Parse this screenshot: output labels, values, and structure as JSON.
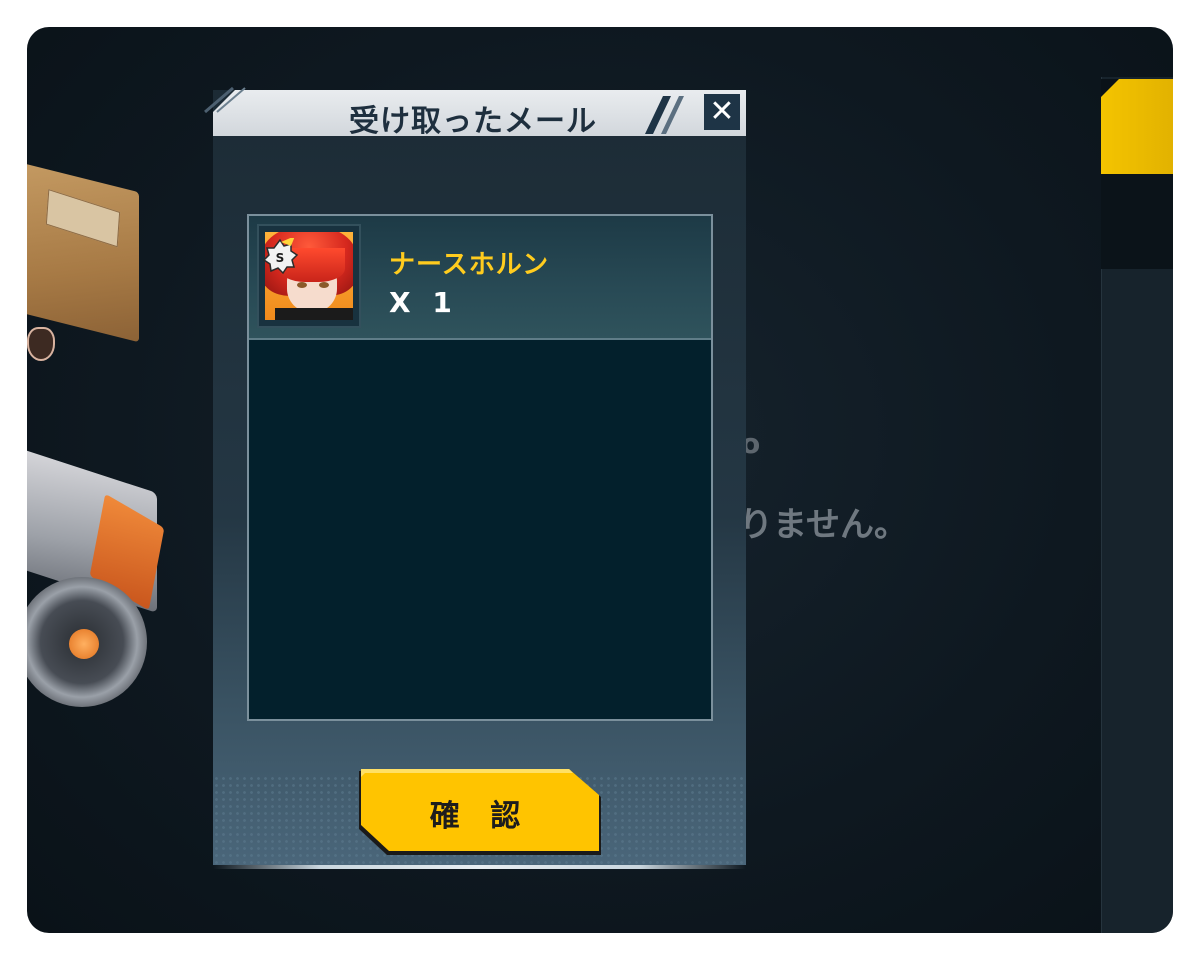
{
  "dialog": {
    "title": "受け取ったメール",
    "close_symbol": "✕",
    "items": [
      {
        "name": "ナースホルン",
        "quantity": "X 1",
        "icon": "character-portrait-icon",
        "badge": "rank-badge-icon"
      }
    ],
    "confirm_label": "確 認"
  },
  "background": {
    "empty_message_fragment": "りません。",
    "dot_fragment": "o"
  },
  "colors": {
    "accent_yellow": "#FFC400",
    "item_name": "#FFCC1E",
    "panel_dark": "#03202C",
    "header_light": "#E9ECEF"
  }
}
